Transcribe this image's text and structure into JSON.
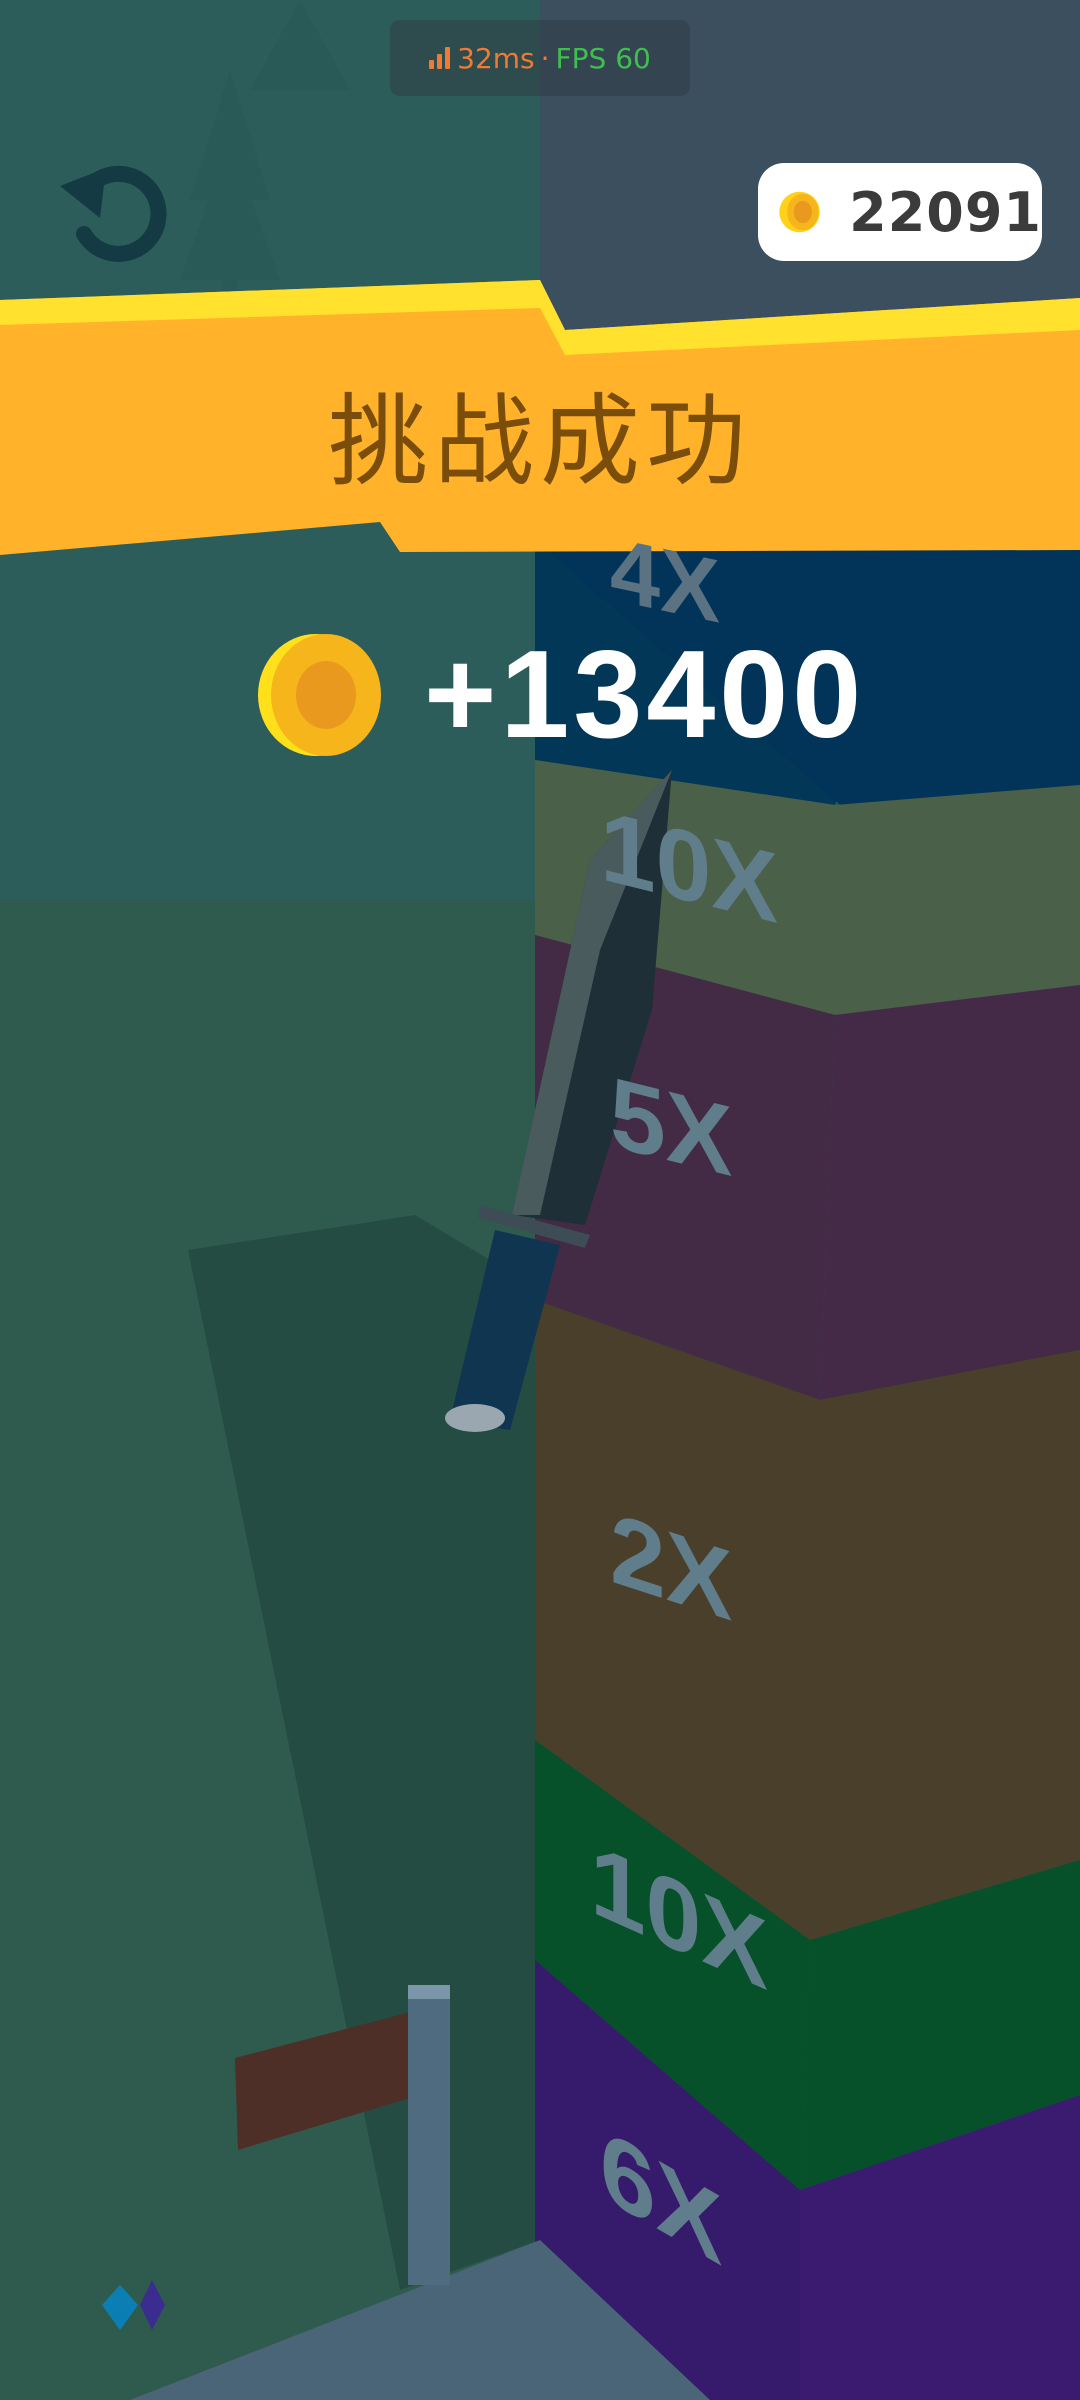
{
  "hud": {
    "ping": "32ms",
    "separator": " · ",
    "fps": "FPS 60",
    "ping_color": "#f07a33",
    "fps_color": "#3fbf4f"
  },
  "coin_counter": {
    "value": "22091",
    "icon": "coin-icon"
  },
  "banner": {
    "title": "挑战成功",
    "color": "#ffb22a"
  },
  "reward": {
    "amount": "+13400",
    "icon": "coin-icon"
  },
  "tower": {
    "multipliers": [
      "4X",
      "10X",
      "5X",
      "2X",
      "10X",
      "6X"
    ]
  },
  "undo": {
    "icon": "undo-icon"
  }
}
